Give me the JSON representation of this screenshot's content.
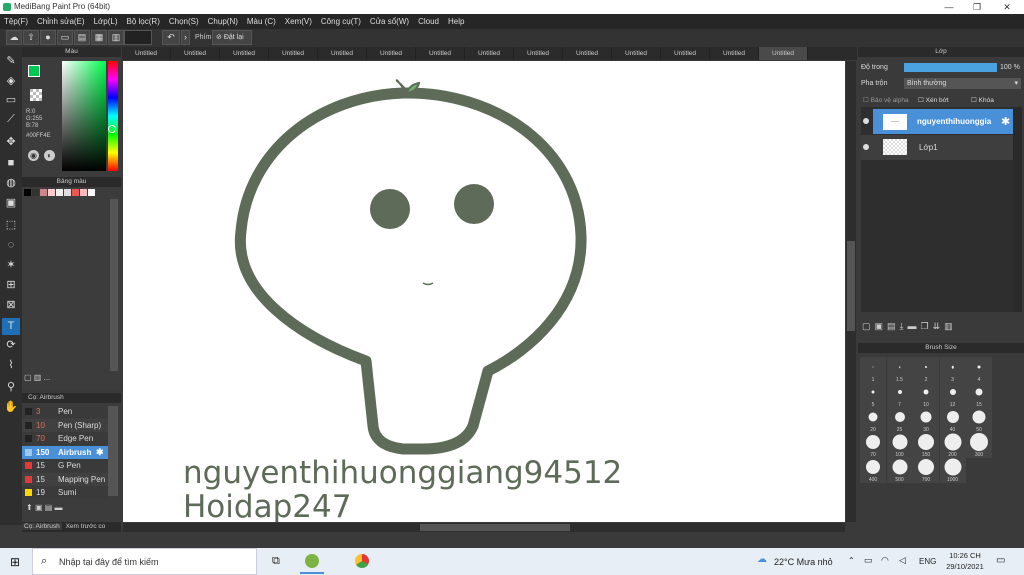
{
  "window": {
    "title": "MediBang Paint Pro (64bit)",
    "min": "—",
    "max": "❐",
    "close": "✕"
  },
  "menu": [
    "Tệp(F)",
    "Chỉnh sửa(E)",
    "Lớp(L)",
    "Bộ lọc(R)",
    "Chọn(S)",
    "Chụp(N)",
    "Màu (C)",
    "Xem(V)",
    "Công cụ(T)",
    "Cửa sổ(W)",
    "Cloud",
    "Help"
  ],
  "toolbar": {
    "key_label": "Phím",
    "reset_label": "Đặt lại"
  },
  "tabs": [
    "Untitled",
    "Untitled",
    "Untitled",
    "Untitled",
    "Untitled",
    "Untitled",
    "Untitled",
    "Untitled",
    "Untitled",
    "Untitled",
    "Untitled",
    "Untitled",
    "Untitled",
    "Untitled"
  ],
  "color_panel": {
    "title": "Màu",
    "r": "R:0",
    "g": "G:255",
    "b": "B:78",
    "hex": "#00FF4E",
    "current_color": "#00c853"
  },
  "palette": {
    "title": "Bảng màu",
    "more": "..."
  },
  "brush_panel": {
    "title": "Cọ: Airbrush",
    "items": [
      {
        "size": "3",
        "name": "Pen",
        "color": "#222222"
      },
      {
        "size": "10",
        "name": "Pen (Sharp)",
        "color": "#222222"
      },
      {
        "size": "70",
        "name": "Edge Pen",
        "color": "#222222"
      },
      {
        "size": "150",
        "name": "Airbrush",
        "color": "#9cc9ee"
      },
      {
        "size": "15",
        "name": "G Pen",
        "color": "#e53935"
      },
      {
        "size": "15",
        "name": "Mapping Pen",
        "color": "#e53935"
      },
      {
        "size": "19",
        "name": "Sumi",
        "color": "#ffd600"
      }
    ],
    "bottom_tabs": [
      "Cọ: Airbrush",
      "Xem trước co"
    ]
  },
  "layer_panel": {
    "title": "Lớp",
    "opacity_label": "Độ trong",
    "opacity_value": "100 %",
    "blend_label": "Pha trộn",
    "blend_value": "Bình thường",
    "protect_alpha": "Bảo vệ alpha",
    "clip": "Xén bớt",
    "lock": "Khóa",
    "layers": [
      "nguyenthihuonggia",
      "Lớp1"
    ]
  },
  "brush_size": {
    "title": "Brush Size",
    "sizes": [
      "1",
      "1.5",
      "2",
      "3",
      "4",
      "5",
      "7",
      "10",
      "12",
      "15",
      "20",
      "25",
      "30",
      "40",
      "50",
      "70",
      "100",
      "150",
      "200",
      "300",
      "400",
      "500",
      "700",
      "1000"
    ]
  },
  "canvas": {
    "watermark_line1": "nguyenthihuonggiang94512",
    "watermark_line2": "Hoidap247"
  },
  "taskbar": {
    "search": "Nhập tại đây để tìm kiếm",
    "weather": "22°C  Mưa nhỏ",
    "lang": "ENG",
    "time": "10:26 CH",
    "date": "29/10/2021"
  }
}
